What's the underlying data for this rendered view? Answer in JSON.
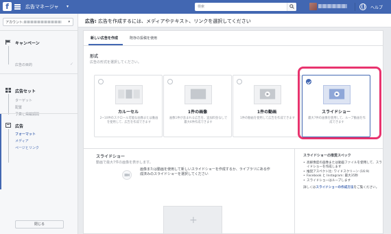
{
  "topbar": {
    "logo": "f",
    "title": "広告マネージャ",
    "search_placeholder": "検索",
    "help": "ヘルプ"
  },
  "sidebar": {
    "account_label": "アカウント:",
    "campaign": {
      "title": "キャンペーン",
      "items": [
        "広告の目的"
      ]
    },
    "adset": {
      "title": "広告セット",
      "items": [
        "ターゲット",
        "配置",
        "予算と掲載期間"
      ]
    },
    "ad": {
      "title": "広告",
      "items": [
        "フォーマット",
        "メディア",
        "ページとリンク"
      ]
    },
    "close_label": "閉じる"
  },
  "main": {
    "header_bold": "広告:",
    "header_text": " 広告を作成するには、メディアやテキスト、リンクを選択してください",
    "tabs": [
      {
        "label": "新しい広告を作成"
      },
      {
        "label": "既存の投稿を使用"
      }
    ],
    "format": {
      "title": "形式",
      "subtitle": "広告の形式を選択してください。",
      "cards": [
        {
          "title": "カルーセル",
          "desc": "2~10件のスクロール可能な画像または動画を使用して、広告を作成できます"
        },
        {
          "title": "1件の画像",
          "desc": "画像1件が含まれる広告を、追加料金なしで最大6件作成できます"
        },
        {
          "title": "1件の動画",
          "desc": "1件の動画を使用して広告を作成できます"
        },
        {
          "title": "スライドショー",
          "desc": "最大7件の画像を使用して、ループ動画を作成できます"
        }
      ]
    },
    "slideshow": {
      "title": "スライドショー",
      "subtitle": "動画で最大7件の画像を表示します。",
      "upload_text": "画像または動画を使用して新しいスライドショーを作成するか、ライブラリにある作成済みのスライドショーを選択してください",
      "add_glyph": "+"
    },
    "specs": {
      "title": "スライドショーの推奨スペック",
      "items": [
        "高解像度の画像または動画ファイルを使用して、スライドショーを作成します",
        "推奨アスペクト比: ワイドスクリーン (16:9)",
        "Facebook と Instagram: 最大35秒",
        "スライドショーはループします"
      ],
      "more_prefix": "詳しくは",
      "more_link": "スライドショーの作成方法",
      "more_suffix": "をご覧ください。"
    }
  },
  "colors": {
    "brand": "#4267b2",
    "highlight": "#e8336e"
  }
}
